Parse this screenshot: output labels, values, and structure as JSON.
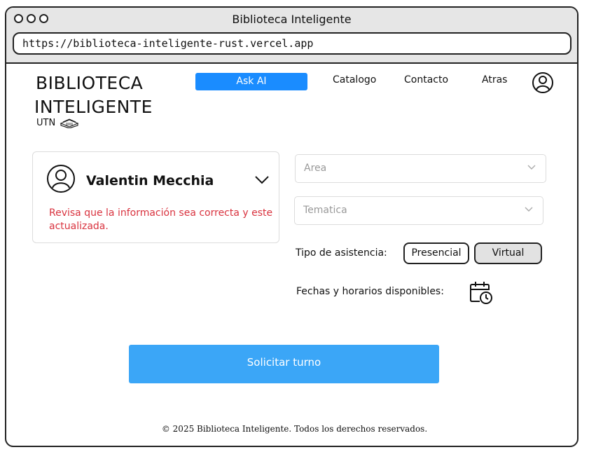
{
  "window": {
    "title": "Biblioteca Inteligente"
  },
  "browser": {
    "url": "https://biblioteca-inteligente-rust.vercel.app"
  },
  "header": {
    "logo_line1": "BIBLIOTECA",
    "logo_line2": "INTELIGENTE",
    "logo_sub": "UTN",
    "ask_ai": "Ask AI",
    "nav": [
      "Catalogo",
      "Contacto",
      "Atras"
    ]
  },
  "user_card": {
    "name": "Valentin Mecchia",
    "message": "Revisa que la información sea correcta y este actualizada."
  },
  "form": {
    "area_placeholder": "Area",
    "tematica_placeholder": "Tematica",
    "asistencia_label": "Tipo de asistencia:",
    "option_presencial": "Presencial",
    "option_virtual": "Virtual",
    "fechas_label": "Fechas y horarios disponibles:",
    "submit": "Solicitar turno"
  },
  "footer": {
    "text": "© 2025 Biblioteca Inteligente. Todos los derechos reservados."
  },
  "colors": {
    "primary": "#1a8cff",
    "submit": "#3ba6f7",
    "warning": "#d9333f"
  }
}
